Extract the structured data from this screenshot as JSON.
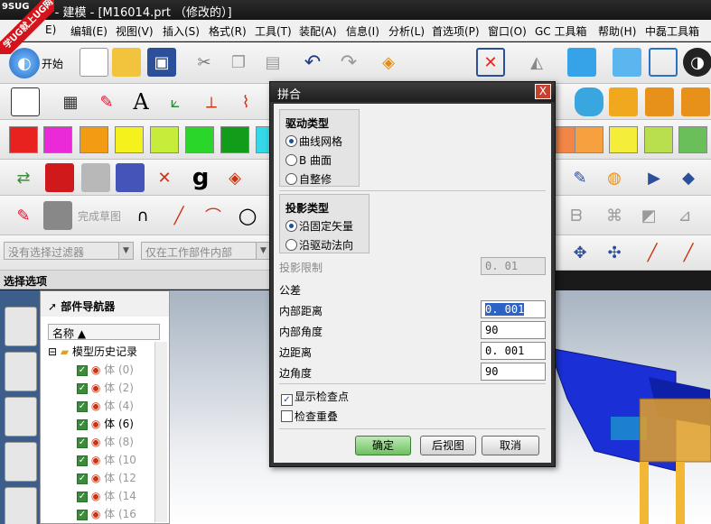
{
  "window": {
    "title": "25 - 建模 - [M16014.prt （修改的）]",
    "badge_text": "学UG就上UG网",
    "badge_tag": "9SUG"
  },
  "menu": [
    "编辑(E)",
    "视图(V)",
    "插入(S)",
    "格式(R)",
    "工具(T)",
    "装配(A)",
    "信息(I)",
    "分析(L)",
    "首选项(P)",
    "窗口(O)",
    "GC 工具箱",
    "帮助(H)",
    "中磊工具箱"
  ],
  "menu_leading": "E)",
  "toolbar": {
    "start_label": "开始",
    "finish_sketch": "完成草图",
    "glyph_text": "A",
    "g_label": "g"
  },
  "colors": [
    "#e8231f",
    "#ea2ad8",
    "#f39b12",
    "#f4f11c",
    "#c6ed3a",
    "#2bd62b",
    "#119c1a",
    "#34d8e8"
  ],
  "colors_right": [
    "#f28646",
    "#f6a040",
    "#f4ee3a",
    "#b9df4f",
    "#6bbf5a"
  ],
  "filters": {
    "type_filter": "没有选择过滤器",
    "scope_filter": "仅在工作部件内部"
  },
  "selection_bar": "选择选项",
  "navigator": {
    "title": "部件导航器",
    "column_name": "名称",
    "root": "模型历史记录",
    "rows": [
      "体 (0)",
      "体 (2)",
      "体 (4)",
      "体 (6)",
      "体 (8)",
      "体 (10",
      "体 (12",
      "体 (14",
      "体 (16"
    ]
  },
  "dialog": {
    "title": "拼合",
    "close": "X",
    "drive_group": "驱动类型",
    "drive_options": [
      "曲线网格",
      "B 曲面",
      "自整修"
    ],
    "drive_selected": 0,
    "proj_group": "投影类型",
    "proj_options": [
      "沿固定矢量",
      "沿驱动法向"
    ],
    "proj_selected": 0,
    "proj_limit_label": "投影限制",
    "proj_limit_value": "0. 01",
    "tolerance_label": "公差",
    "inner_dist_label": "内部距离",
    "inner_dist_value": "0. 001",
    "inner_angle_label": "内部角度",
    "inner_angle_value": "90",
    "edge_dist_label": "边距离",
    "edge_dist_value": "0. 001",
    "edge_angle_label": "边角度",
    "edge_angle_value": "90",
    "show_check_label": "显示检查点",
    "show_check": true,
    "check_overlap_label": "检查重叠",
    "check_overlap": false,
    "ok": "确定",
    "back": "后视图",
    "cancel": "取消"
  }
}
